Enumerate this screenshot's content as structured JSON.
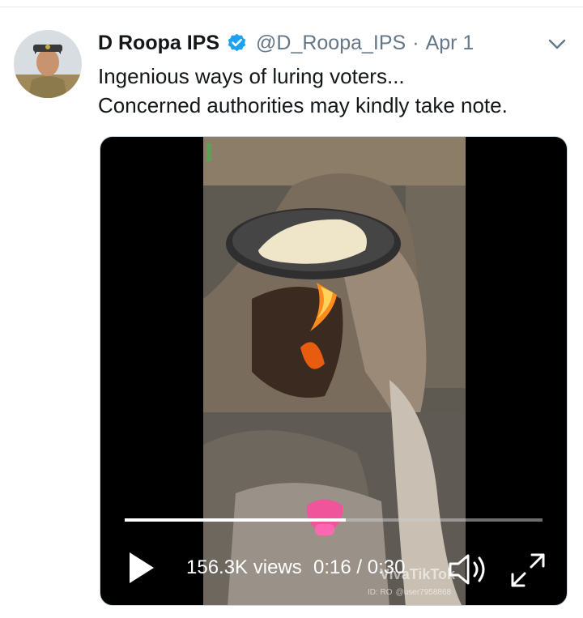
{
  "author": {
    "name": "D Roopa IPS",
    "handle": "@D_Roopa_IPS",
    "separator": "·",
    "date": "Apr 1"
  },
  "tweet": {
    "lines": [
      "Ingenious ways of luring voters...",
      "Concerned authorities may kindly take note."
    ]
  },
  "video": {
    "views": "156.3K views",
    "time": "0:16 / 0:30",
    "progress": 0.53,
    "watermark": "VivaTikTok",
    "watermark_id_label": "ID: RO",
    "watermark_user": "@user7958868"
  },
  "colors": {
    "link": "#1da1f2",
    "secondary_text": "#657786",
    "primary_text": "#14171a"
  },
  "icons": {
    "verified": "verified-badge-icon",
    "caret": "chevron-down-icon",
    "play": "play-icon",
    "volume": "volume-icon",
    "fullscreen": "fullscreen-icon"
  }
}
